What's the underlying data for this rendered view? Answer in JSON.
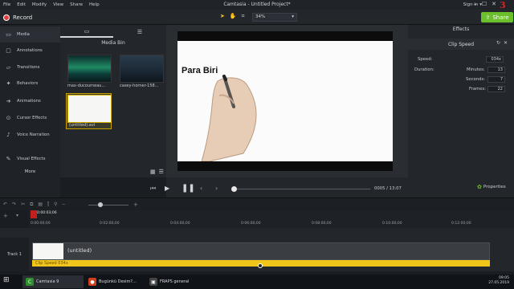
{
  "menu": {
    "items": [
      "File",
      "Edit",
      "Modify",
      "View",
      "Share",
      "Help"
    ]
  },
  "window": {
    "title": "Camtasia - Untitled Project*",
    "signin": "Sign In",
    "fps_badge": "3"
  },
  "toolbar": {
    "record_label": "Record",
    "zoom": "34%",
    "share_label": "Share"
  },
  "nav": {
    "items": [
      {
        "label": "Media",
        "icon": "media-icon"
      },
      {
        "label": "Annotations",
        "icon": "annotations-icon"
      },
      {
        "label": "Transitions",
        "icon": "transitions-icon"
      },
      {
        "label": "Behaviors",
        "icon": "behaviors-icon"
      },
      {
        "label": "Animations",
        "icon": "animations-icon"
      },
      {
        "label": "Cursor Effects",
        "icon": "cursor-effects-icon"
      },
      {
        "label": "Voice Narration",
        "icon": "microphone-icon"
      },
      {
        "label": "Visual Effects",
        "icon": "visual-effects-icon"
      }
    ],
    "more": "More"
  },
  "media_bin": {
    "title": "Media Bin",
    "items": [
      {
        "name": "max-ducourneau..."
      },
      {
        "name": "casey-horner-158..."
      },
      {
        "name": "(untitled).avi"
      }
    ]
  },
  "canvas": {
    "text": "Para Biri"
  },
  "effects": {
    "header": "Effects",
    "clip_speed": "Clip Speed",
    "speed_label": "Speed:",
    "speed_value": "034x",
    "duration_label": "Duration:",
    "minutes_label": "Minutes:",
    "minutes_value": "13",
    "seconds_label": "Seconds:",
    "seconds_value": "7",
    "frames_label": "Frames:",
    "frames_value": "22",
    "properties": "Properties"
  },
  "playback": {
    "time": "0005 / 13:07"
  },
  "timeline": {
    "playhead_time": "0:00:03;06",
    "ticks": [
      "0:00:00;00",
      "0:02:00;00",
      "0:04:00;00",
      "0:06:00;00",
      "0:08:00;00",
      "0:10:00;00",
      "0:12:00;00"
    ],
    "track_label": "Track 1",
    "clip_label": "(untitled)",
    "speed_label": "Clip Speed 034x"
  },
  "taskbar": {
    "items": [
      {
        "label": "Camtasia 9",
        "color": "#2f8f2f"
      },
      {
        "label": "Bugünkü Desim?...",
        "color": "#d04020"
      },
      {
        "label": "FRAPS general",
        "color": "#444444"
      }
    ],
    "time": "09:05",
    "date": "27.05.2019"
  }
}
